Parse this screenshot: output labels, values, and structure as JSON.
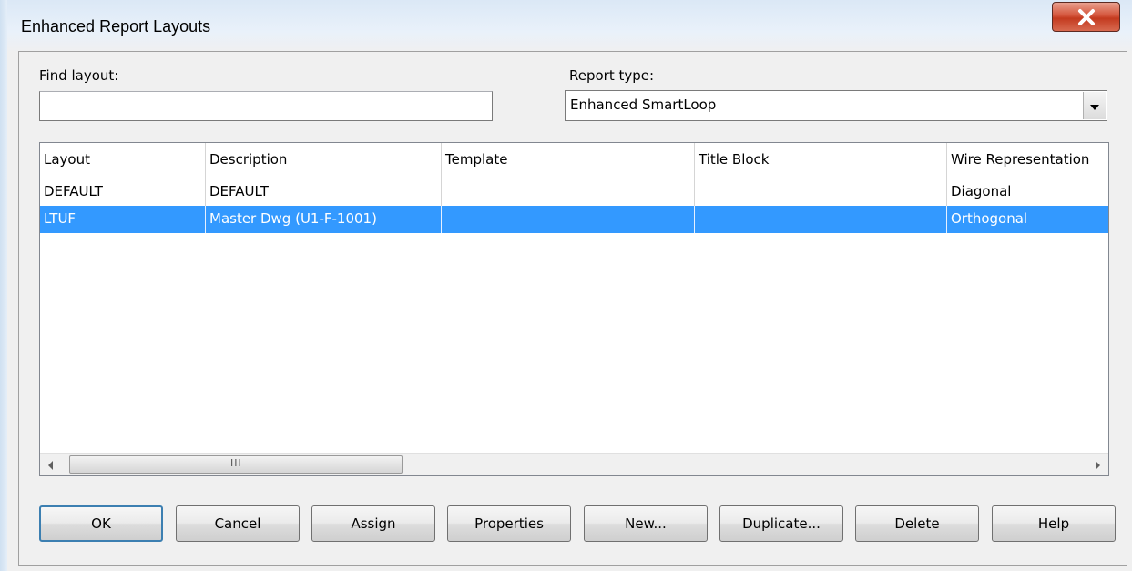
{
  "window": {
    "title": "Enhanced Report Layouts",
    "close_icon": "close-x-icon"
  },
  "find": {
    "label": "Find layout:",
    "value": "",
    "placeholder": ""
  },
  "report_type": {
    "label": "Report type:",
    "selected": "Enhanced SmartLoop"
  },
  "table": {
    "columns": [
      "Layout",
      "Description",
      "Template",
      "Title Block",
      "Wire Representation"
    ],
    "rows": [
      {
        "layout": "DEFAULT",
        "description": "DEFAULT",
        "template": "",
        "title_block": "",
        "wire_representation": "Diagonal",
        "selected": false
      },
      {
        "layout": "LTUF",
        "description": "Master Dwg (U1-F-1001)",
        "template": "",
        "title_block": "",
        "wire_representation": "Orthogonal",
        "selected": true
      }
    ],
    "scroll_thumb_grip": "III"
  },
  "buttons": {
    "ok": "OK",
    "cancel": "Cancel",
    "assign": "Assign",
    "properties": "Properties",
    "new": "New...",
    "duplicate": "Duplicate...",
    "delete": "Delete",
    "help": "Help"
  },
  "colors": {
    "selection": "#3399ff",
    "close_button": "#c9452b"
  }
}
